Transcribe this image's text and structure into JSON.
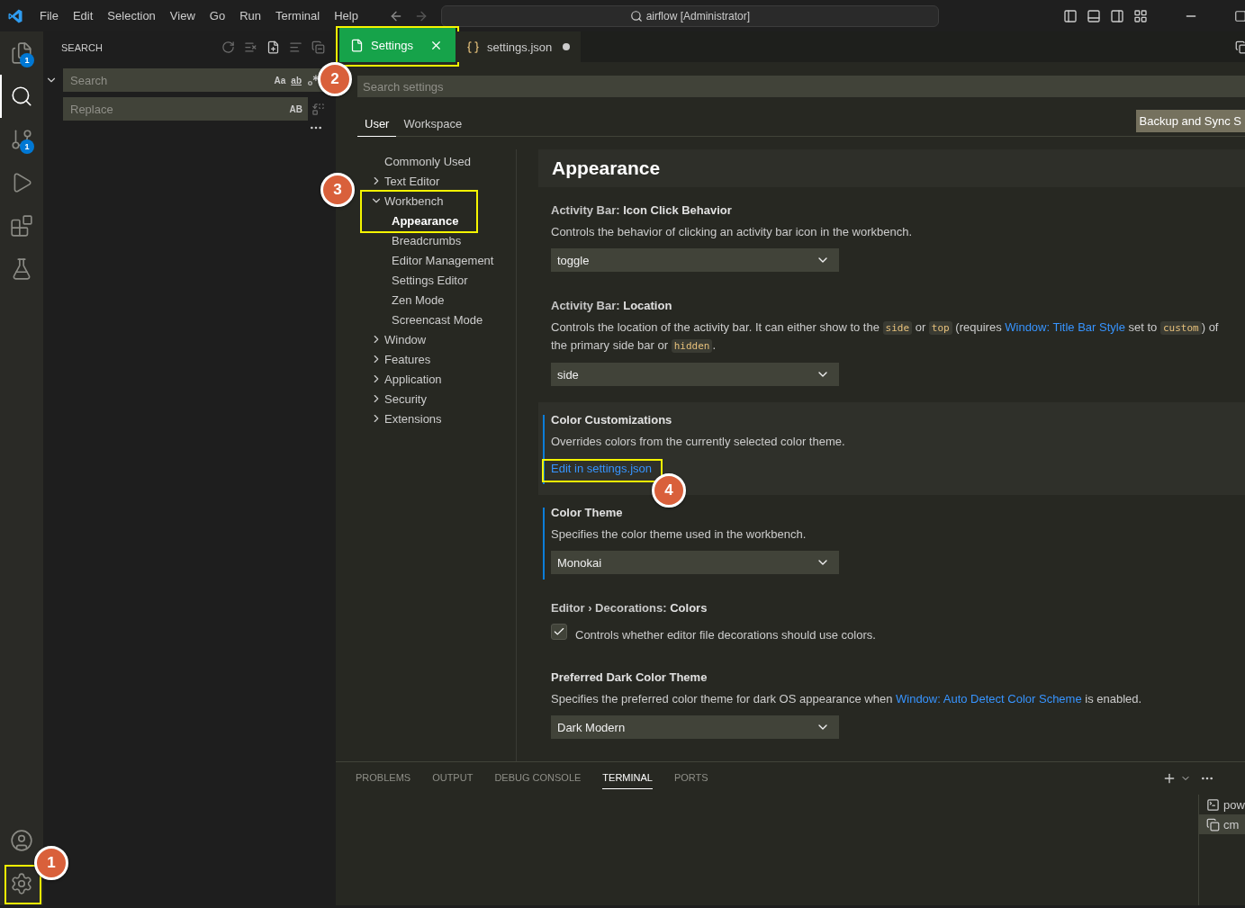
{
  "menu": [
    "File",
    "Edit",
    "Selection",
    "View",
    "Go",
    "Run",
    "Terminal",
    "Help"
  ],
  "command_center": "airflow [Administrator]",
  "activity_bar": [
    {
      "kind": "files",
      "badge": "1",
      "selected": false
    },
    {
      "kind": "search",
      "selected": true
    },
    {
      "kind": "source-control",
      "badge": "1",
      "selected": false
    },
    {
      "kind": "run",
      "selected": false
    },
    {
      "kind": "extensions",
      "selected": false
    },
    {
      "kind": "testing",
      "selected": false
    }
  ],
  "activity_bottom": [
    {
      "kind": "accounts"
    },
    {
      "kind": "manage",
      "callout": "1"
    }
  ],
  "sidebar": {
    "title": "SEARCH",
    "search": {
      "placeholder": "Search",
      "toggles": [
        "Aa",
        "ab"
      ]
    },
    "replace": {
      "placeholder": "Replace",
      "toggle": "AB"
    }
  },
  "tabs": [
    {
      "label": "Settings",
      "kind": "settings",
      "selected": true,
      "dirty": false,
      "callout": "2"
    },
    {
      "label": "settings.json",
      "kind": "json",
      "selected": false,
      "dirty": true
    }
  ],
  "settings": {
    "search": {
      "placeholder": "Search settings"
    },
    "scopes": [
      {
        "label": "User",
        "selected": true
      },
      {
        "label": "Workspace",
        "selected": false
      }
    ],
    "sync_button": "Backup and Sync S",
    "toc": [
      {
        "label": "Commonly Used",
        "selected": false
      },
      {
        "label": "Text Editor",
        "selected": false,
        "expanded": false
      },
      {
        "label": "Workbench",
        "selected": false,
        "expanded": true,
        "callout": "3",
        "children": [
          {
            "label": "Appearance",
            "selected": true
          },
          {
            "label": "Breadcrumbs",
            "selected": false
          },
          {
            "label": "Editor Management",
            "selected": false
          },
          {
            "label": "Settings Editor",
            "selected": false
          },
          {
            "label": "Zen Mode",
            "selected": false
          },
          {
            "label": "Screencast Mode",
            "selected": false
          }
        ]
      },
      {
        "label": "Window",
        "selected": false,
        "expanded": false
      },
      {
        "label": "Features",
        "selected": false,
        "expanded": false
      },
      {
        "label": "Application",
        "selected": false,
        "expanded": false
      },
      {
        "label": "Security",
        "selected": false,
        "expanded": false
      },
      {
        "label": "Extensions",
        "selected": false,
        "expanded": false
      }
    ],
    "section_title": "Appearance",
    "items": [
      {
        "kind": "select",
        "category": "Activity Bar: ",
        "name": "Icon Click Behavior",
        "modified": false,
        "focused": false,
        "description": [
          {
            "kind": "text",
            "text": "Controls the behavior of clicking an activity bar icon in the workbench."
          }
        ],
        "value": "toggle"
      },
      {
        "kind": "select",
        "category": "Activity Bar: ",
        "name": "Location",
        "modified": false,
        "focused": false,
        "description": [
          {
            "kind": "text",
            "text": "Controls the location of the activity bar. It can either show to the "
          },
          {
            "kind": "code",
            "text": "side"
          },
          {
            "kind": "text",
            "text": " or "
          },
          {
            "kind": "code",
            "text": "top"
          },
          {
            "kind": "text",
            "text": " (requires "
          },
          {
            "kind": "link",
            "text": "Window: Title Bar Style"
          },
          {
            "kind": "text",
            "text": " set to "
          },
          {
            "kind": "code",
            "text": "custom"
          },
          {
            "kind": "text",
            "text": ") of the primary side bar or "
          },
          {
            "kind": "code",
            "text": "hidden"
          },
          {
            "kind": "text",
            "text": "."
          }
        ],
        "value": "side"
      },
      {
        "kind": "link",
        "name": "Color Customizations",
        "modified": true,
        "focused": true,
        "description": [
          {
            "kind": "text",
            "text": "Overrides colors from the currently selected color theme."
          }
        ],
        "link": "Edit in settings.json",
        "callout": "4"
      },
      {
        "kind": "select",
        "name": "Color Theme",
        "modified": true,
        "focused": false,
        "description": [
          {
            "kind": "text",
            "text": "Specifies the color theme used in the workbench."
          }
        ],
        "value": "Monokai"
      },
      {
        "kind": "checkbox",
        "category": "Editor › Decorations: ",
        "name": "Colors",
        "modified": false,
        "focused": false,
        "description": [
          {
            "kind": "text",
            "text": "Controls whether editor file decorations should use colors."
          }
        ],
        "checked": true
      },
      {
        "kind": "select",
        "name": "Preferred Dark Color Theme",
        "modified": false,
        "focused": false,
        "description": [
          {
            "kind": "text",
            "text": "Specifies the preferred color theme for dark OS appearance when "
          },
          {
            "kind": "link",
            "text": "Window: Auto Detect Color Scheme"
          },
          {
            "kind": "text",
            "text": " is enabled."
          }
        ],
        "value": "Dark Modern"
      }
    ]
  },
  "panel": {
    "tabs": [
      {
        "label": "PROBLEMS",
        "selected": false
      },
      {
        "label": "OUTPUT",
        "selected": false
      },
      {
        "label": "DEBUG CONSOLE",
        "selected": false
      },
      {
        "label": "TERMINAL",
        "selected": true
      },
      {
        "label": "PORTS",
        "selected": false
      }
    ],
    "terminals": [
      {
        "kind": "powershell",
        "label": "pow",
        "selected": false
      },
      {
        "kind": "cmd",
        "label": "cm",
        "selected": true
      }
    ]
  }
}
